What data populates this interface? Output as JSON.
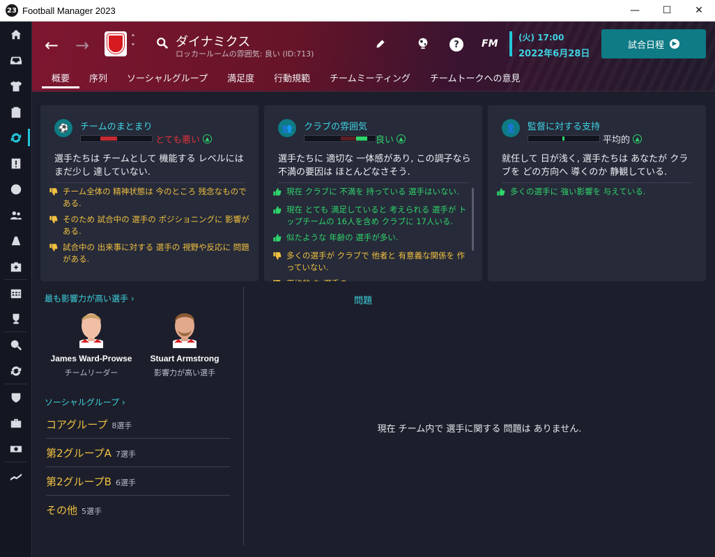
{
  "window": {
    "badge": "23",
    "title": "Football Manager 2023",
    "minimize": "—",
    "maximize": "☐",
    "close": "✕"
  },
  "header": {
    "team_title": "ダイナミクス",
    "subtitle": "ロッカールームの雰囲気: 良い (ID:713)",
    "date_line1": "(火) 17:00",
    "date_line2": "2022年6月28日",
    "continue_label": "試合日程",
    "fm_label": "FM",
    "help_label": "?"
  },
  "tabs": [
    "概要",
    "序列",
    "ソーシャルグループ",
    "満足度",
    "行動規範",
    "チームミーティング",
    "チームトークへの意見"
  ],
  "cards": {
    "cohesion": {
      "title": "チームのまとまり",
      "rating": "とても悪い",
      "rating_color": "#e0333a",
      "description": "選手たちは チームとして 機能する レベルには まだ少し 達していない.",
      "items": [
        {
          "type": "bad",
          "text": "チーム全体の 精神状態は 今のところ 残念なものである."
        },
        {
          "type": "bad",
          "text": "そのため 試合中の 選手の ポジショニングに 影響がある."
        },
        {
          "type": "bad",
          "text": "試合中の 出来事に対する 選手の 視野や反応に 問題がある."
        }
      ]
    },
    "atmosphere": {
      "title": "クラブの雰囲気",
      "rating": "良い",
      "rating_color": "#2fd46a",
      "description": "選手たちに 適切な 一体感があり, この調子なら 不満の要因は ほとんどなさそう.",
      "items": [
        {
          "type": "good",
          "text": "現在 クラブに 不満を 持っている 選手はいない."
        },
        {
          "type": "good",
          "text": "現在 とても 満足していると 考えられる 選手が トップチームの 16人を含め クラブに 17人いる."
        },
        {
          "type": "good",
          "text": "似たような 年齢の 選手が多い."
        },
        {
          "type": "bad",
          "text": "多くの選手が クラブで 他者と 有意義な関係を 作っていない."
        },
        {
          "type": "bad",
          "text": "平均的 な 選手の"
        }
      ]
    },
    "support": {
      "title": "監督に対する支持",
      "rating": "平均的",
      "rating_color": "#e6e8ee",
      "description": "就任して 日が浅く, 選手たちは あなたが クラブを どの方向へ 導くのか 静観している.",
      "items": [
        {
          "type": "good",
          "text": "多くの選手に 強い影響を 与えている."
        }
      ]
    }
  },
  "influential": {
    "heading": "最も影響力が高い選手",
    "players": [
      {
        "name": "James Ward-Prowse",
        "role": "チームリーダー"
      },
      {
        "name": "Stuart Armstrong",
        "role": "影響力が高い選手"
      }
    ]
  },
  "social_groups": {
    "heading": "ソーシャルグループ",
    "groups": [
      {
        "name": "コアグループ",
        "count": "8選手"
      },
      {
        "name": "第2グループA",
        "count": "7選手"
      },
      {
        "name": "第2グループB",
        "count": "6選手"
      },
      {
        "name": "その他",
        "count": "5選手"
      }
    ]
  },
  "issues": {
    "title": "問題",
    "empty_text": "現在 チーム内で 選手に関する 問題は ありません."
  },
  "colors": {
    "accent": "#23c6d8",
    "good": "#2fd46a",
    "bad": "#f0c040",
    "header_red": "#7e1630"
  }
}
